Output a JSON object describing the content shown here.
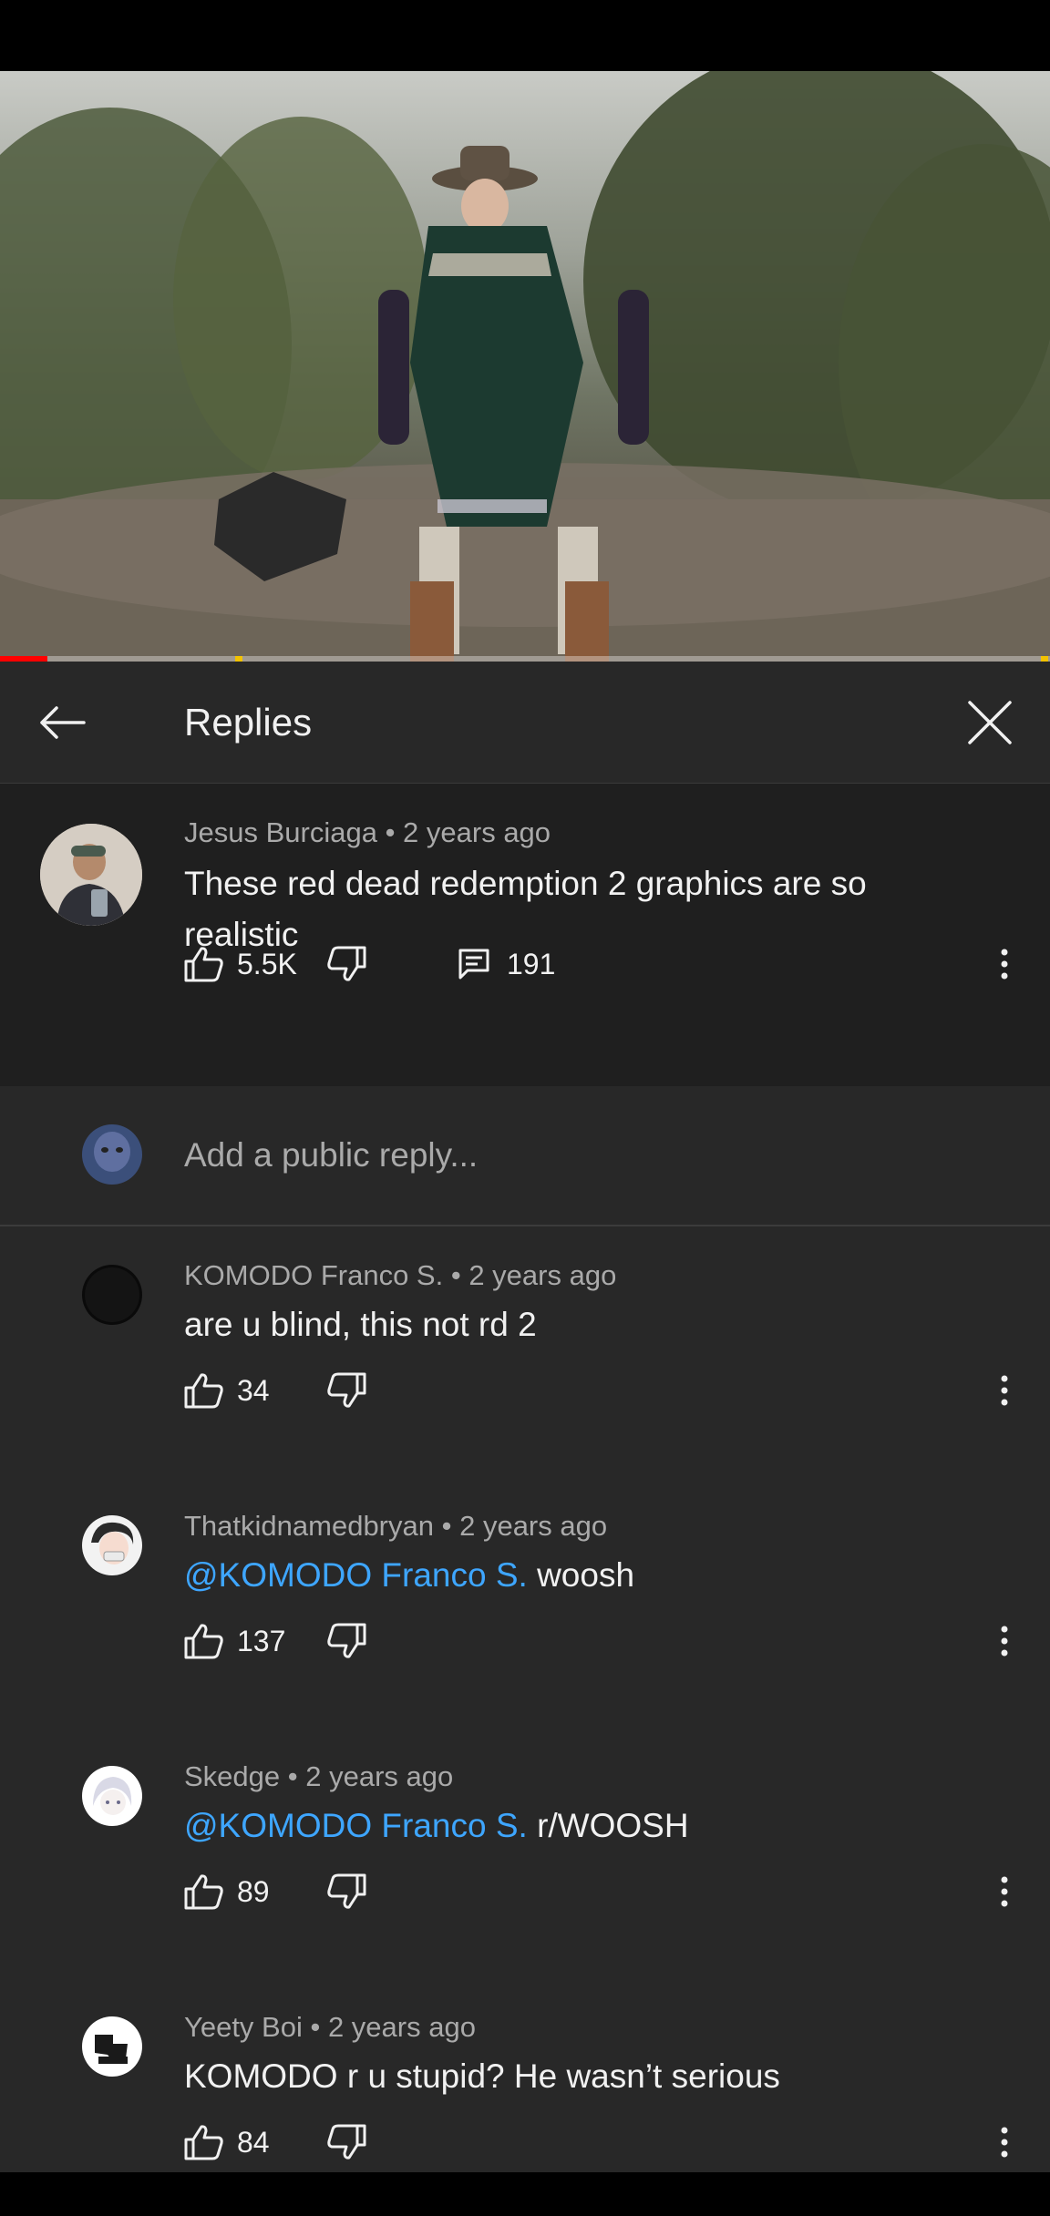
{
  "panel": {
    "title": "Replies",
    "back_icon": "arrow-left-icon",
    "close_icon": "close-icon"
  },
  "video": {
    "progress_fraction": 0.045
  },
  "parent_comment": {
    "author": "Jesus Burciaga",
    "age": "2 years ago",
    "text": "These red dead redemption 2 graphics are so realistic",
    "likes": "5.5K",
    "replies": "191"
  },
  "reply_box": {
    "placeholder": "Add a public reply..."
  },
  "replies": [
    {
      "author": "KOMODO Franco S.",
      "age": "2 years ago",
      "mention": "",
      "text": "are u blind, this not rd 2",
      "likes": "34"
    },
    {
      "author": "Thatkidnamedbryan",
      "age": "2 years ago",
      "mention": "@KOMODO Franco S.",
      "text": " woosh",
      "likes": "137"
    },
    {
      "author": "Skedge",
      "age": "2 years ago",
      "mention": "@KOMODO Franco S.",
      "text": " r/WOOSH",
      "likes": "89"
    },
    {
      "author": "Yeety Boi",
      "age": "2 years ago",
      "mention": "",
      "text": "KOMODO r u stupid? He wasn’t serious",
      "likes": "84"
    }
  ],
  "separator": " • ",
  "colors": {
    "background": "#282828",
    "parent_background": "#1f1f1f",
    "mention": "#3ea6ff",
    "meta_text": "#aaaaaa",
    "progress": "#ff0000"
  }
}
